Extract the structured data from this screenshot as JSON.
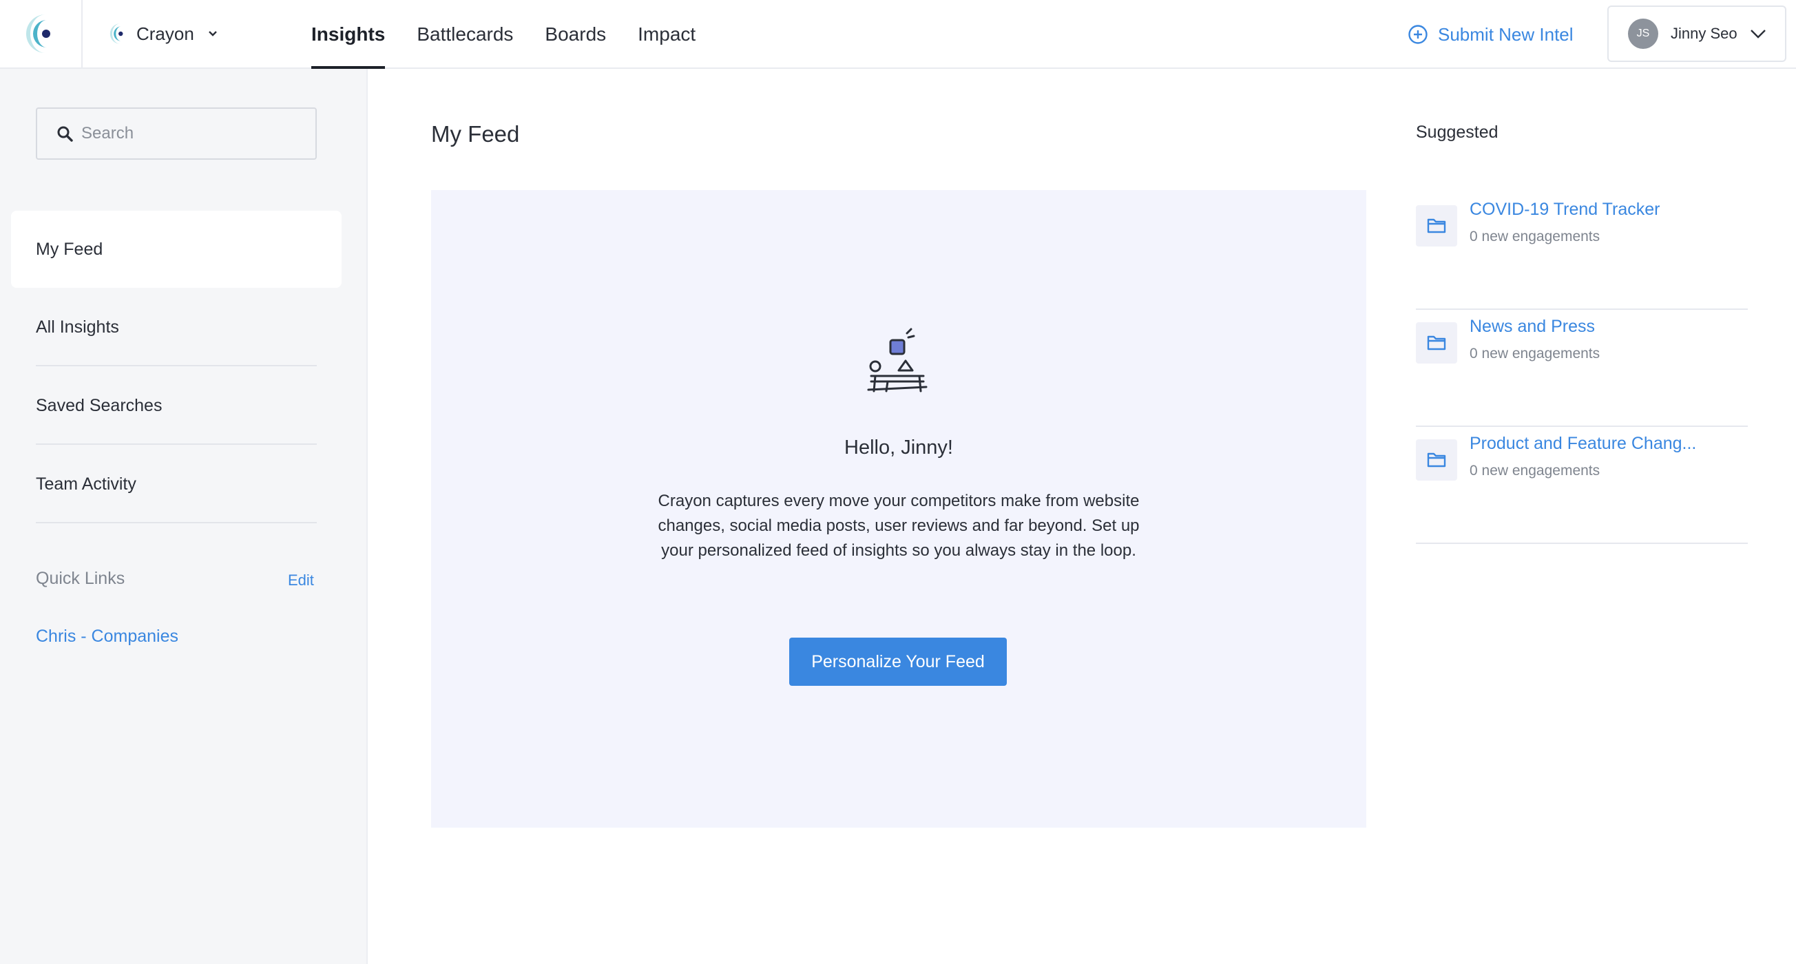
{
  "header": {
    "workspace_name": "Crayon",
    "nav_tabs": [
      {
        "label": "Insights",
        "active": true
      },
      {
        "label": "Battlecards",
        "active": false
      },
      {
        "label": "Boards",
        "active": false
      },
      {
        "label": "Impact",
        "active": false
      }
    ],
    "submit_intel_label": "Submit New Intel",
    "user": {
      "initials": "JS",
      "name": "Jinny Seo"
    }
  },
  "sidebar": {
    "search_placeholder": "Search",
    "items": [
      {
        "label": "My Feed",
        "active": true
      },
      {
        "label": "All Insights",
        "active": false
      },
      {
        "label": "Saved Searches",
        "active": false
      },
      {
        "label": "Team Activity",
        "active": false
      }
    ],
    "quick_links": {
      "title": "Quick Links",
      "edit_label": "Edit",
      "links": [
        "Chris - Companies"
      ]
    }
  },
  "main": {
    "title": "My Feed",
    "empty_state": {
      "greeting": "Hello, Jinny!",
      "description": "Crayon captures every move your competitors make from website changes, social media posts, user reviews and far beyond. Set up your personalized feed of insights so you always stay in the loop.",
      "cta_label": "Personalize Your Feed"
    }
  },
  "suggested": {
    "title": "Suggested",
    "items": [
      {
        "name": "COVID-19 Trend Tracker",
        "meta": "0 new engagements"
      },
      {
        "name": "News and Press",
        "meta": "0 new engagements"
      },
      {
        "name": "Product and Feature Chang...",
        "meta": "0 new engagements"
      }
    ]
  },
  "colors": {
    "accent": "#3a87e0",
    "sidebar_bg": "#f5f6f8",
    "card_bg": "#f3f4fd",
    "illustration_square": "#6f7ed6"
  },
  "icons": {
    "app_logo": "crayon-logo-icon",
    "workspace_logo": "crayon-logo-icon",
    "workspace_caret": "chevron-down-icon",
    "submit_intel": "plus-circle-icon",
    "user_caret": "chevron-down-icon",
    "search": "search-icon",
    "suggested_item": "folder-icon",
    "empty_state": "shapes-table-illustration"
  }
}
